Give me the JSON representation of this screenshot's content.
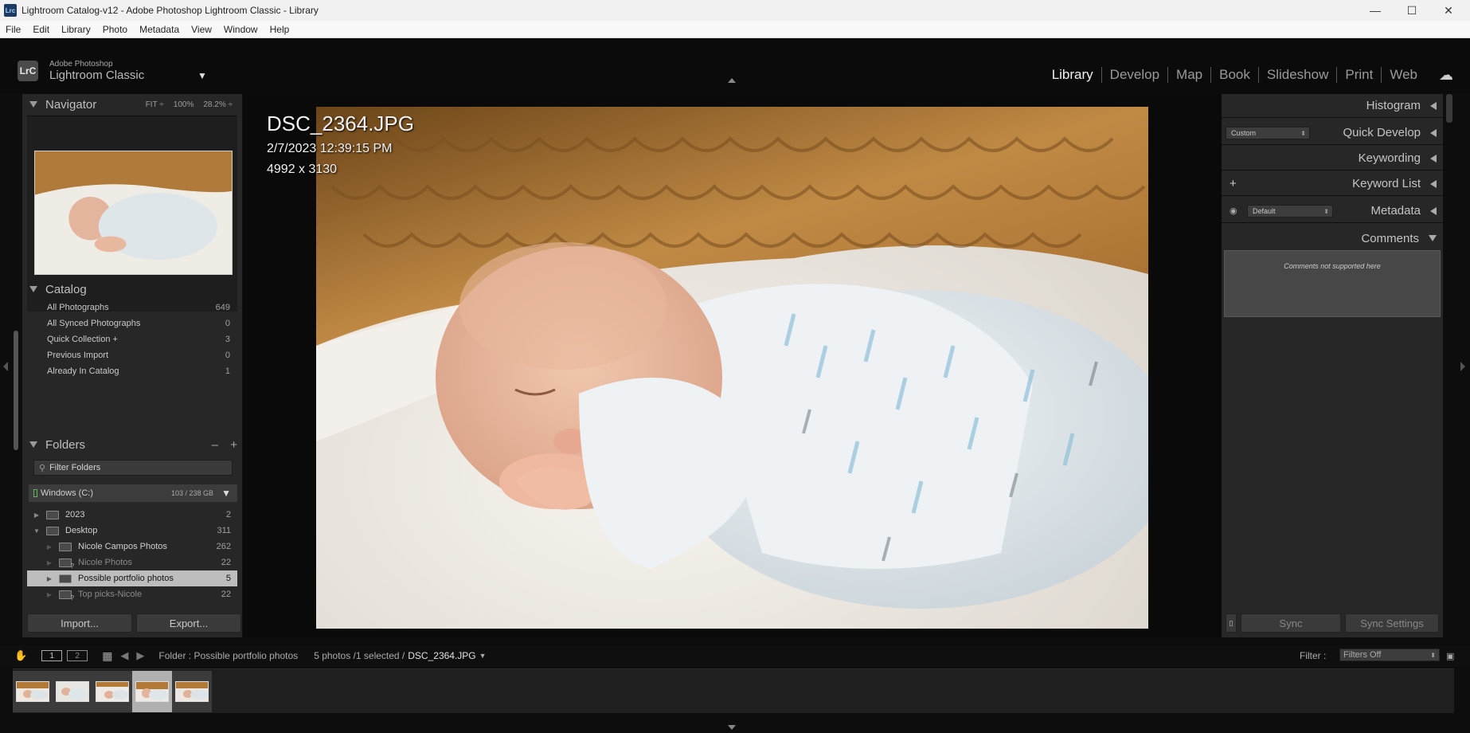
{
  "window": {
    "title": "Lightroom Catalog-v12 - Adobe Photoshop Lightroom Classic - Library",
    "app_icon": "Lrc"
  },
  "menu": [
    "File",
    "Edit",
    "Library",
    "Photo",
    "Metadata",
    "View",
    "Window",
    "Help"
  ],
  "brand": {
    "logo": "LrC",
    "line1": "Adobe Photoshop",
    "line2": "Lightroom Classic"
  },
  "modules": [
    "Library",
    "Develop",
    "Map",
    "Book",
    "Slideshow",
    "Print",
    "Web"
  ],
  "active_module": "Library",
  "navigator": {
    "title": "Navigator",
    "fit": "FIT ÷",
    "z100": "100%",
    "zoom": "28.2% ÷"
  },
  "catalog": {
    "title": "Catalog",
    "items": [
      {
        "label": "All Photographs",
        "count": "649"
      },
      {
        "label": "All Synced Photographs",
        "count": "0"
      },
      {
        "label": "Quick Collection +",
        "count": "3"
      },
      {
        "label": "Previous Import",
        "count": "0"
      },
      {
        "label": "Already In Catalog",
        "count": "1"
      }
    ]
  },
  "folders": {
    "title": "Folders",
    "minus": "–",
    "plus": "+",
    "filter_placeholder": "Filter Folders",
    "volume": {
      "name": "Windows (C:)",
      "usage": "103 / 238 GB"
    },
    "items": [
      {
        "label": "2023",
        "count": "2"
      },
      {
        "label": "Desktop",
        "count": "311"
      },
      {
        "label": "Nicole Campos Photos",
        "count": "262"
      },
      {
        "label": "Nicole Photos",
        "count": "22"
      },
      {
        "label": "Possible portfolio photos",
        "count": "5"
      },
      {
        "label": "Top picks-Nicole",
        "count": "22"
      }
    ]
  },
  "left_buttons": {
    "import": "Import...",
    "export": "Export..."
  },
  "photo_info": {
    "filename": "DSC_2364.JPG",
    "datetime": "2/7/2023 12:39:15 PM",
    "dimensions": "4992 x 3130"
  },
  "right_panels": {
    "histogram": "Histogram",
    "quick_develop": "Quick Develop",
    "quick_develop_preset": "Custom",
    "keywording": "Keywording",
    "keyword_list": "Keyword List",
    "keyword_add": "+",
    "metadata": "Metadata",
    "metadata_preset": "Default",
    "comments": "Comments",
    "comments_note": "Comments not supported here",
    "sync": "Sync",
    "sync_settings": "Sync Settings"
  },
  "filmstrip_bar": {
    "monitor1": "1",
    "monitor2": "2",
    "source": "Folder : Possible portfolio photos",
    "count": "5 photos /1 selected /",
    "current": "DSC_2364.JPG",
    "filter_label": "Filter :",
    "filter_value": "Filters Off"
  },
  "filmstrip": {
    "thumb_count": 5,
    "selected_index": 3
  },
  "colors": {
    "panel": "#272727",
    "background": "#0d0d0d",
    "selection": "#bdbdbd",
    "text": "#bbbbbb"
  }
}
